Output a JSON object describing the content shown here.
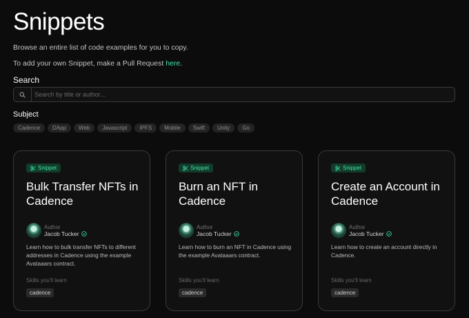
{
  "header": {
    "title": "Snippets",
    "description": "Browse an entire list of code examples for you to copy.",
    "contribute_prefix": "To add your own Snippet, make a Pull Request ",
    "contribute_link": "here",
    "contribute_suffix": "."
  },
  "search": {
    "label": "Search",
    "placeholder": "Search by title or author..."
  },
  "subject": {
    "label": "Subject",
    "chips": [
      "Cadence",
      "DApp",
      "Web",
      "Javascript",
      "IPFS",
      "Mobile",
      "Swift",
      "Unity",
      "Go"
    ]
  },
  "cards": [
    {
      "badge": "Snippet",
      "title": "Bulk Transfer NFTs in Cadence",
      "author_label": "Author",
      "author_name": "Jacob Tucker",
      "description": "Learn how to bulk transfer NFTs to different addresses in Cadence using the example Avataaars contract.",
      "skills_label": "Skills you'll learn",
      "skill": "cadence"
    },
    {
      "badge": "Snippet",
      "title": "Burn an NFT in Cadence",
      "author_label": "Author",
      "author_name": "Jacob Tucker",
      "description": "Learn how to burn an NFT in Cadence using the example Avataaars contract.",
      "skills_label": "Skills you'll learn",
      "skill": "cadence"
    },
    {
      "badge": "Snippet",
      "title": "Create an Account in Cadence",
      "author_label": "Author",
      "author_name": "Jacob Tucker",
      "description": "Learn how to create an account directly in Cadence.",
      "skills_label": "Skills you'll learn",
      "skill": "cadence"
    }
  ],
  "colors": {
    "background": "#0c0c0c",
    "accent": "#3ee6a6",
    "badge_bg": "#123c2c"
  },
  "icons": {
    "search": "search-icon",
    "snippet": "scissors-icon",
    "verified": "verified-check-icon"
  }
}
